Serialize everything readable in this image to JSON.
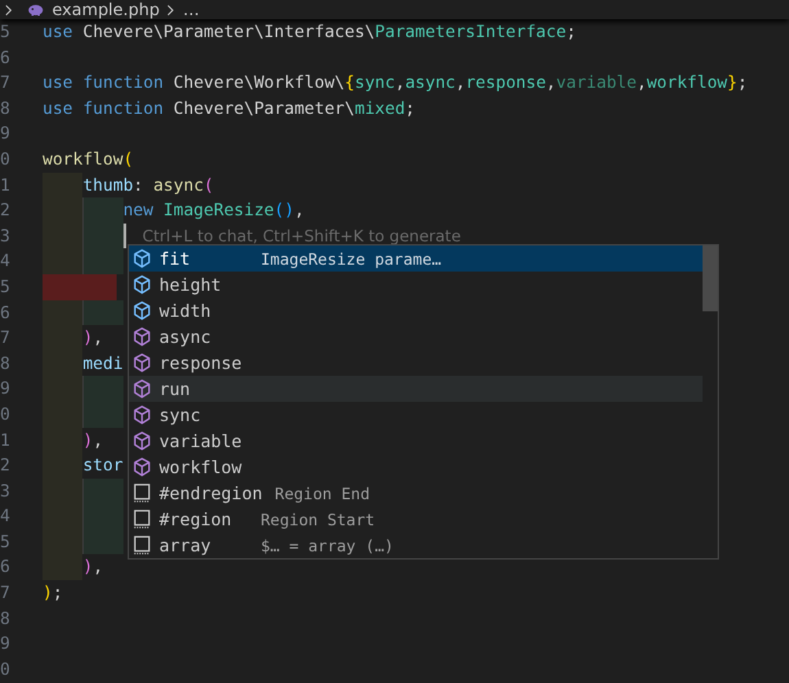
{
  "breadcrumb": {
    "items": [
      "example.php",
      "…"
    ]
  },
  "editor": {
    "lines": [
      {
        "number": "5",
        "tokens": [
          {
            "text": "use",
            "kind": "keyword"
          },
          {
            "text": " Chevere\\Parameter\\Interfaces\\",
            "kind": "plain"
          },
          {
            "text": "ParametersInterface",
            "kind": "type"
          },
          {
            "text": ";",
            "kind": "plain"
          }
        ]
      },
      {
        "number": "6"
      },
      {
        "number": "7",
        "tokens": [
          {
            "text": "use function",
            "kind": "keyword"
          },
          {
            "text": " Chevere\\Workflow\\",
            "kind": "plain"
          },
          {
            "text": "{",
            "kind": "bracket1"
          },
          {
            "text": "sync",
            "kind": "type"
          },
          {
            "text": ",",
            "kind": "plain"
          },
          {
            "text": "async",
            "kind": "type"
          },
          {
            "text": ",",
            "kind": "plain"
          },
          {
            "text": "response",
            "kind": "type"
          },
          {
            "text": ",",
            "kind": "plain"
          },
          {
            "text": "variable",
            "kind": "type-dim"
          },
          {
            "text": ",",
            "kind": "plain"
          },
          {
            "text": "workflow",
            "kind": "type"
          },
          {
            "text": "}",
            "kind": "bracket1"
          },
          {
            "text": ";",
            "kind": "plain"
          }
        ]
      },
      {
        "number": "8",
        "tokens": [
          {
            "text": "use function",
            "kind": "keyword"
          },
          {
            "text": " Chevere\\Parameter\\",
            "kind": "plain"
          },
          {
            "text": "mixed",
            "kind": "type"
          },
          {
            "text": ";",
            "kind": "plain"
          }
        ]
      },
      {
        "number": "9"
      },
      {
        "number": "0",
        "tokens": [
          {
            "text": "workflow",
            "kind": "call"
          },
          {
            "text": "(",
            "kind": "bracket1"
          }
        ]
      },
      {
        "number": "1",
        "indent": [
          {
            "kind": "outer"
          }
        ],
        "tokens": [
          {
            "text": "thumb",
            "kind": "param"
          },
          {
            "text": ": ",
            "kind": "plain"
          },
          {
            "text": "async",
            "kind": "call"
          },
          {
            "text": "(",
            "kind": "bracket2"
          }
        ]
      },
      {
        "number": "2",
        "indent": [
          {
            "kind": "outer"
          },
          {
            "kind": "inner"
          }
        ],
        "tokens": [
          {
            "text": "new ",
            "kind": "keyword"
          },
          {
            "text": "ImageResize",
            "kind": "type"
          },
          {
            "text": "()",
            "kind": "bracket3"
          },
          {
            "text": ",",
            "kind": "plain"
          }
        ]
      },
      {
        "number": "3",
        "indent": [
          {
            "kind": "outer"
          },
          {
            "kind": "inner"
          }
        ],
        "cursor": true,
        "ghost": "Ctrl+L to chat, Ctrl+Shift+K to generate"
      },
      {
        "number": "4",
        "indent": [
          {
            "kind": "outer"
          },
          {
            "kind": "inner"
          }
        ]
      },
      {
        "number": "5",
        "indent": [
          {
            "kind": "error"
          }
        ]
      },
      {
        "number": "6",
        "indent": [
          {
            "kind": "outer"
          },
          {
            "kind": "inner"
          }
        ]
      },
      {
        "number": "7",
        "indent": [
          {
            "kind": "outer"
          }
        ],
        "tokens": [
          {
            "text": ")",
            "kind": "bracket2"
          },
          {
            "text": ",",
            "kind": "plain"
          }
        ]
      },
      {
        "number": "8",
        "indent": [
          {
            "kind": "outer"
          }
        ],
        "tokens": [
          {
            "text": "medi",
            "kind": "param"
          }
        ]
      },
      {
        "number": "9",
        "indent": [
          {
            "kind": "outer"
          },
          {
            "kind": "inner"
          }
        ]
      },
      {
        "number": "0",
        "indent": [
          {
            "kind": "outer"
          },
          {
            "kind": "inner"
          }
        ]
      },
      {
        "number": "1",
        "indent": [
          {
            "kind": "outer"
          }
        ],
        "tokens": [
          {
            "text": ")",
            "kind": "bracket2"
          },
          {
            "text": ",",
            "kind": "plain"
          }
        ]
      },
      {
        "number": "2",
        "indent": [
          {
            "kind": "outer"
          }
        ],
        "tokens": [
          {
            "text": "stor",
            "kind": "param"
          }
        ]
      },
      {
        "number": "3",
        "indent": [
          {
            "kind": "outer"
          },
          {
            "kind": "inner"
          }
        ]
      },
      {
        "number": "4",
        "indent": [
          {
            "kind": "outer"
          },
          {
            "kind": "inner"
          }
        ]
      },
      {
        "number": "5",
        "indent": [
          {
            "kind": "outer"
          },
          {
            "kind": "inner"
          }
        ]
      },
      {
        "number": "6",
        "indent": [
          {
            "kind": "outer"
          }
        ],
        "tokens": [
          {
            "text": ")",
            "kind": "bracket2"
          },
          {
            "text": ",",
            "kind": "plain"
          }
        ]
      },
      {
        "number": "7",
        "tokens": [
          {
            "text": ")",
            "kind": "bracket1"
          },
          {
            "text": ";",
            "kind": "plain"
          }
        ]
      },
      {
        "number": "8"
      },
      {
        "number": "9"
      },
      {
        "number": "0"
      }
    ]
  },
  "suggestions": [
    {
      "label": "fit",
      "detail": "ImageResize parame…",
      "kind": "field",
      "selected": true,
      "hovered": false
    },
    {
      "label": "height",
      "kind": "field",
      "selected": false,
      "hovered": false
    },
    {
      "label": "width",
      "kind": "field",
      "selected": false,
      "hovered": false
    },
    {
      "label": "async",
      "kind": "function",
      "selected": false,
      "hovered": false
    },
    {
      "label": "response",
      "kind": "function",
      "selected": false,
      "hovered": false
    },
    {
      "label": "run",
      "kind": "function",
      "selected": false,
      "hovered": true
    },
    {
      "label": "sync",
      "kind": "function",
      "selected": false,
      "hovered": false
    },
    {
      "label": "variable",
      "kind": "function",
      "selected": false,
      "hovered": false
    },
    {
      "label": "workflow",
      "kind": "function",
      "selected": false,
      "hovered": false
    },
    {
      "label": "#endregion",
      "detail": "Region End",
      "kind": "snippet",
      "selected": false,
      "hovered": false
    },
    {
      "label": "#region",
      "detail": "Region Start",
      "kind": "snippet",
      "selected": false,
      "hovered": false
    },
    {
      "label": "array",
      "detail": "$… = array (…)",
      "kind": "snippet",
      "selected": false,
      "hovered": false
    }
  ]
}
